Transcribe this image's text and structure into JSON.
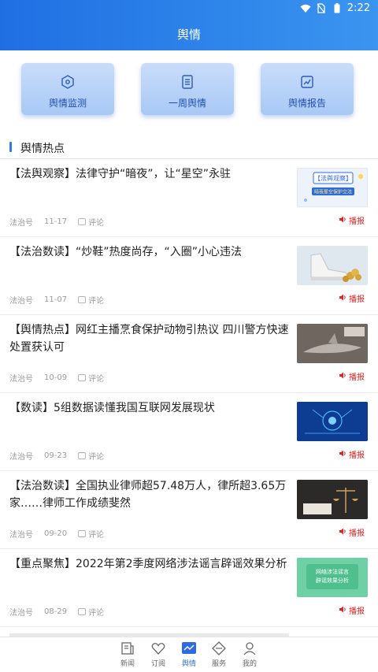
{
  "status_bar": {
    "time": "2:22"
  },
  "header": {
    "title": "舆情"
  },
  "quick_actions": [
    {
      "label": "舆情监测",
      "icon": "radar-icon"
    },
    {
      "label": "一周舆情",
      "icon": "document-list-icon"
    },
    {
      "label": "舆情报告",
      "icon": "report-chart-icon"
    }
  ],
  "section": {
    "title": "舆情热点"
  },
  "news": [
    {
      "title": "【法舆观察】法律守护“暗夜”，让“星空”永驻",
      "source": "法治号",
      "date": "11-17",
      "comment_label": "评论",
      "play_label": "播报",
      "thumb": {
        "line1": "【法舆观察】",
        "line2": "暗夜星空保护立法",
        "bg": "#eef3fb",
        "accent": "#2f6be0"
      }
    },
    {
      "title": "【法治数读】“炒鞋”热度尚存，“入圈”小心违法",
      "source": "法治号",
      "date": "11-07",
      "comment_label": "评论",
      "play_label": "播报",
      "thumb": {
        "bg": "#dfe7ef",
        "accent": "#d4a63a"
      }
    },
    {
      "title": "【舆情热点】网红主播烹食保护动物引热议 四川警方快速处置获认可",
      "source": "法治号",
      "date": "10-09",
      "comment_label": "评论",
      "play_label": "播报",
      "thumb": {
        "bg": "#8a7f77",
        "accent": "#b9b2ac"
      }
    },
    {
      "title": "【数读】5组数据读懂我国互联网发展现状",
      "source": "法治号",
      "date": "09-23",
      "comment_label": "评论",
      "play_label": "播报",
      "thumb": {
        "bg": "#1146a8",
        "accent": "#4fb6ff"
      }
    },
    {
      "title": "【法治数读】全国执业律师超57.48万人，律所超3.65万家……律师工作成绩斐然",
      "source": "法治号",
      "date": "09-20",
      "comment_label": "评论",
      "play_label": "播报",
      "thumb": {
        "bg": "#2c2a28",
        "accent": "#c9a05a"
      }
    },
    {
      "title": "【重点聚焦】2022年第2季度网络涉法谣言辟谣效果分析",
      "source": "法治号",
      "date": "08-29",
      "comment_label": "评论",
      "play_label": "播报",
      "thumb": {
        "line1": "网络涉法谣言",
        "line2": "辟谣效果分析",
        "bg": "#6fd0a6",
        "accent": "#ffffff"
      }
    }
  ],
  "bottom_nav": [
    {
      "label": "新闻",
      "icon": "newspaper-icon",
      "active": false
    },
    {
      "label": "订阅",
      "icon": "heart-icon",
      "active": false
    },
    {
      "label": "舆情",
      "icon": "trend-icon",
      "active": true
    },
    {
      "label": "服务",
      "icon": "diamond-icon",
      "active": false
    },
    {
      "label": "我的",
      "icon": "person-icon",
      "active": false
    }
  ],
  "colors": {
    "header_start": "#1f6fe3",
    "header_end": "#3a95ef",
    "accent": "#2f6be0",
    "play": "#e02424"
  }
}
